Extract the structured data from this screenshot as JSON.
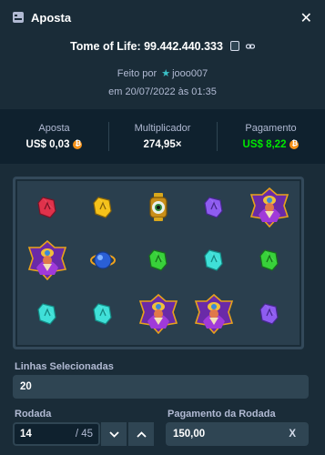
{
  "header": {
    "title": "Aposta",
    "close_icon": "close-icon",
    "bet_icon": "bet-ticket-icon"
  },
  "bet": {
    "game_title": "Tome of Life: 99.442.440.333",
    "made_by_prefix": "Feito por",
    "user": "jooo007",
    "date": "em 20/07/2022 às 01:35"
  },
  "stats": {
    "bet_label": "Aposta",
    "bet_value": "US$ 0,03",
    "multiplier_label": "Multiplicador",
    "multiplier_value": "274,95×",
    "payout_label": "Pagamento",
    "payout_value": "US$ 8,22"
  },
  "board": {
    "rows": [
      [
        "red-gem",
        "yellow-gem",
        "eye-lantern",
        "purple-gem",
        "wizard"
      ],
      [
        "wizard",
        "blue-orb",
        "green-gem",
        "cyan-gem",
        "green-gem"
      ],
      [
        "cyan-gem",
        "cyan-gem",
        "wizard",
        "wizard",
        "purple-gem"
      ]
    ]
  },
  "lines": {
    "label": "Linhas Selecionadas",
    "value": "20"
  },
  "round": {
    "label": "Rodada",
    "value": "14",
    "total": "/ 45"
  },
  "round_payout": {
    "label": "Pagamento da Rodada",
    "value": "150,00",
    "suffix": "X"
  },
  "colors": {
    "background": "#1a2c38",
    "panel": "#0f212e",
    "accent_green": "#00e701",
    "coin": "#f7931a"
  }
}
